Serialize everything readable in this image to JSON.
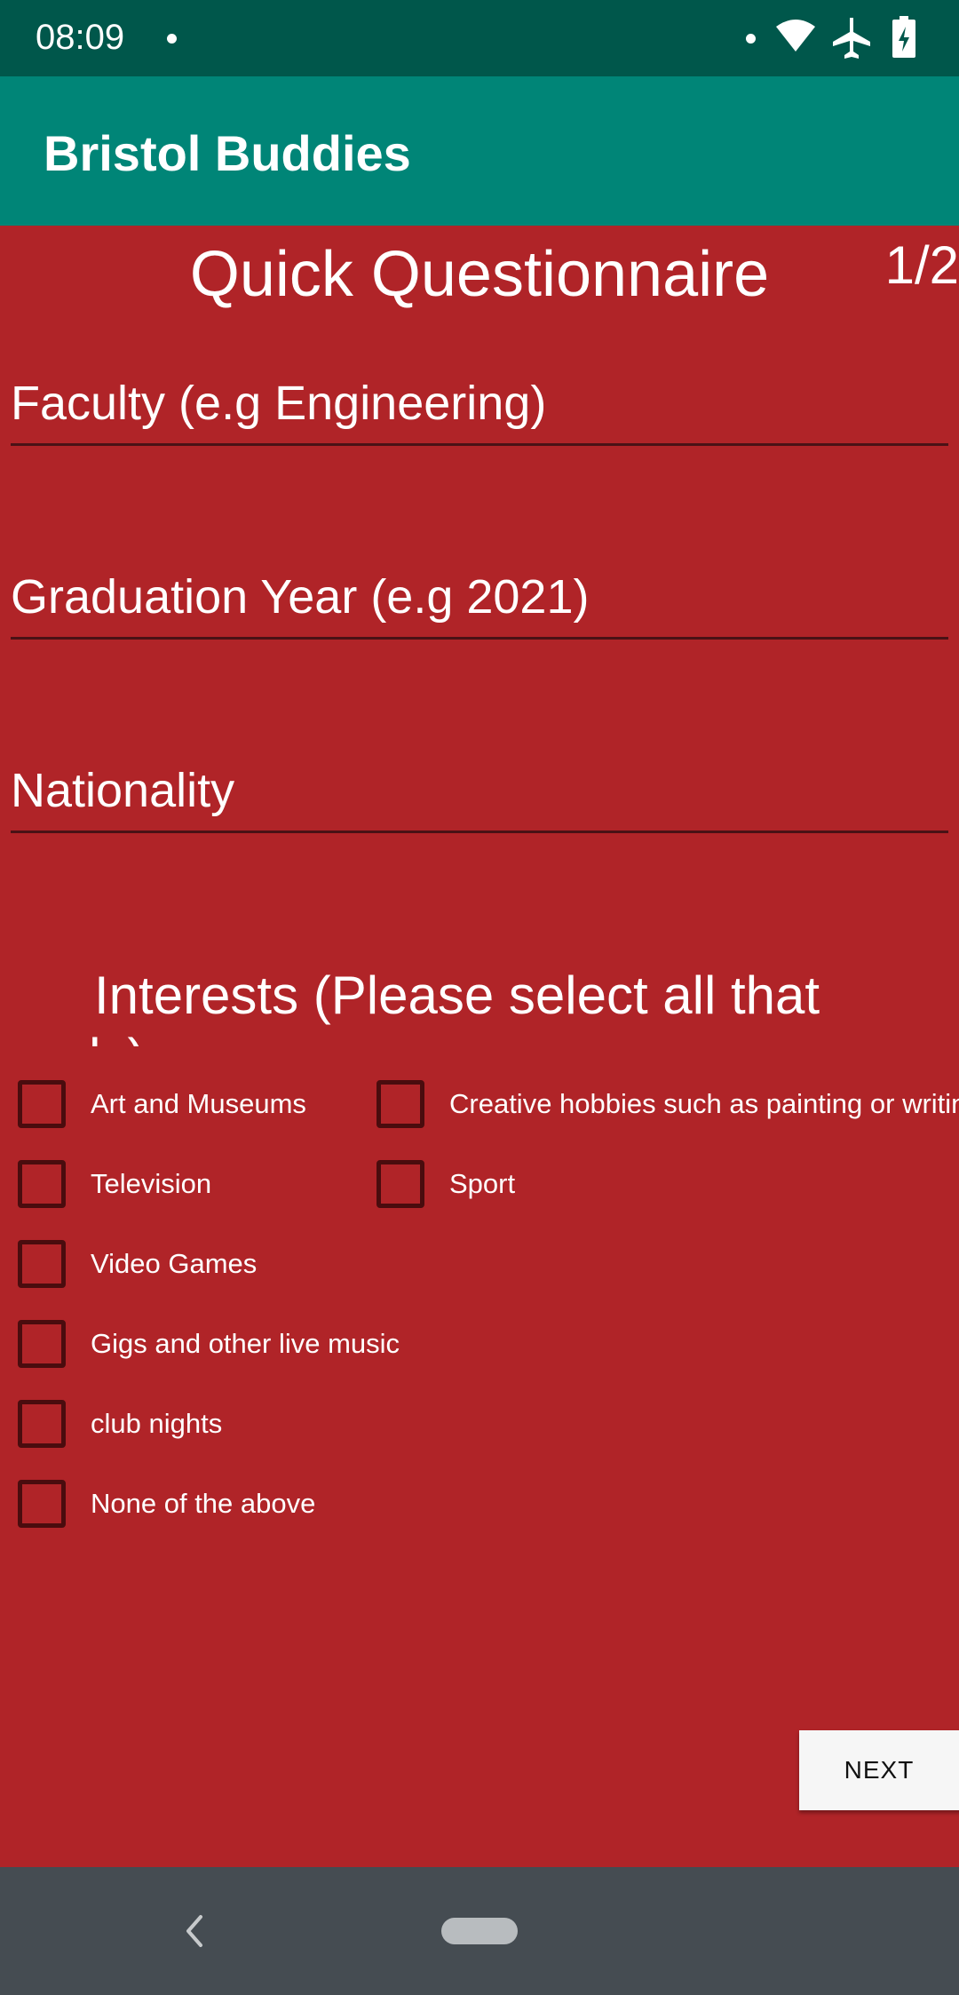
{
  "status_bar": {
    "time": "08:09",
    "icons": [
      "notification-dot-icon",
      "wifi-icon",
      "airplane-mode-icon",
      "battery-charging-icon"
    ]
  },
  "app_bar": {
    "title": "Bristol Buddies",
    "color": "#008577"
  },
  "questionnaire": {
    "title": "Quick Questionnaire",
    "page_counter": "1/2",
    "background": "#b02428",
    "fields": {
      "faculty": {
        "placeholder": "Faculty (e.g Engineering)",
        "value": ""
      },
      "graduation_year": {
        "placeholder": "Graduation Year (e.g 2021)",
        "value": ""
      },
      "nationality": {
        "placeholder": "Nationality",
        "value": ""
      }
    },
    "interests_heading": "Interests (Please select all that apply)",
    "interests": [
      {
        "label": "Art and Museums",
        "checked": false
      },
      {
        "label": "Creative hobbies such as painting or writing",
        "checked": false
      },
      {
        "label": "Television",
        "checked": false
      },
      {
        "label": "Sport",
        "checked": false
      },
      {
        "label": "Video Games",
        "checked": false
      },
      {
        "label": "Gigs and other live music",
        "checked": false
      },
      {
        "label": "club nights",
        "checked": false
      },
      {
        "label": "None of the above",
        "checked": false
      }
    ],
    "next_label": "NEXT"
  },
  "nav_bar": {
    "icons": [
      "back-icon",
      "home-pill-icon"
    ]
  }
}
